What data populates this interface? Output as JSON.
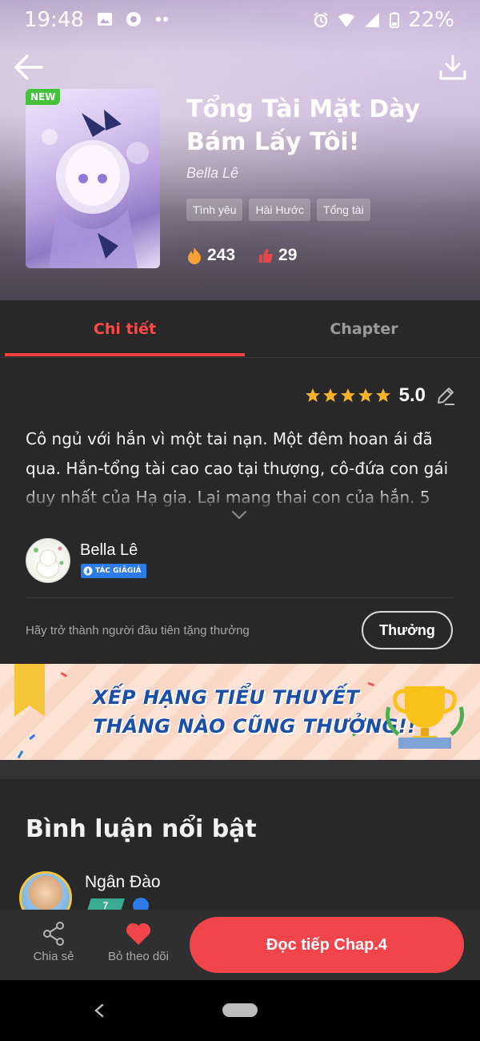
{
  "status_bar": {
    "time": "19:48",
    "battery_percent": "22%",
    "icons": [
      "image-icon",
      "chrome-icon",
      "more-dots-icon",
      "alarm-icon",
      "wifi-icon",
      "signal-icon",
      "battery-icon"
    ]
  },
  "header": {
    "back_icon": "arrow-left-icon",
    "download_icon": "download-icon"
  },
  "book": {
    "badge": "NEW",
    "title": "Tổng Tài Mặt Dày Bám Lấy Tôi!",
    "author": "Bella Lê",
    "genres": [
      "Tình yêu",
      "Hài Hước",
      "Tổng tài"
    ],
    "fire_count": "243",
    "like_count": "29"
  },
  "tabs": [
    {
      "label": "Chi tiết",
      "active": true
    },
    {
      "label": "Chapter",
      "active": false
    }
  ],
  "details": {
    "rating_value": "5.0",
    "stars": 5,
    "synopsis": "Cô ngủ với hắn vì một tai nạn. Một đêm hoan ái đã qua. Hắn-tổng tài cao cao tại thượng, cô-đứa con gái duy nhất của Hạ gia. Lại mang thai con của hắn. 5",
    "author_name": "Bella Lê",
    "author_badge": "TÁC GIẢGIẢ",
    "reward_prompt": "Hãy trở thành người đầu tiên tặng thưởng",
    "reward_button": "Thưởng"
  },
  "banner": {
    "line1": "XẾP HẠNG TIỂU THUYẾT",
    "line2": "THÁNG NÀO CŨNG THƯỞNG!!"
  },
  "comments": {
    "title": "Bình luận nổi bật",
    "first_user": "Ngân Đào",
    "first_user_level": "7"
  },
  "bottom_bar": {
    "share_label": "Chia sẻ",
    "follow_label": "Bỏ theo dõi",
    "continue_label": "Đọc tiếp Chap.4"
  },
  "colors": {
    "accent": "#f2454b",
    "tab_active": "#ff4a4a",
    "background": "#282828"
  }
}
